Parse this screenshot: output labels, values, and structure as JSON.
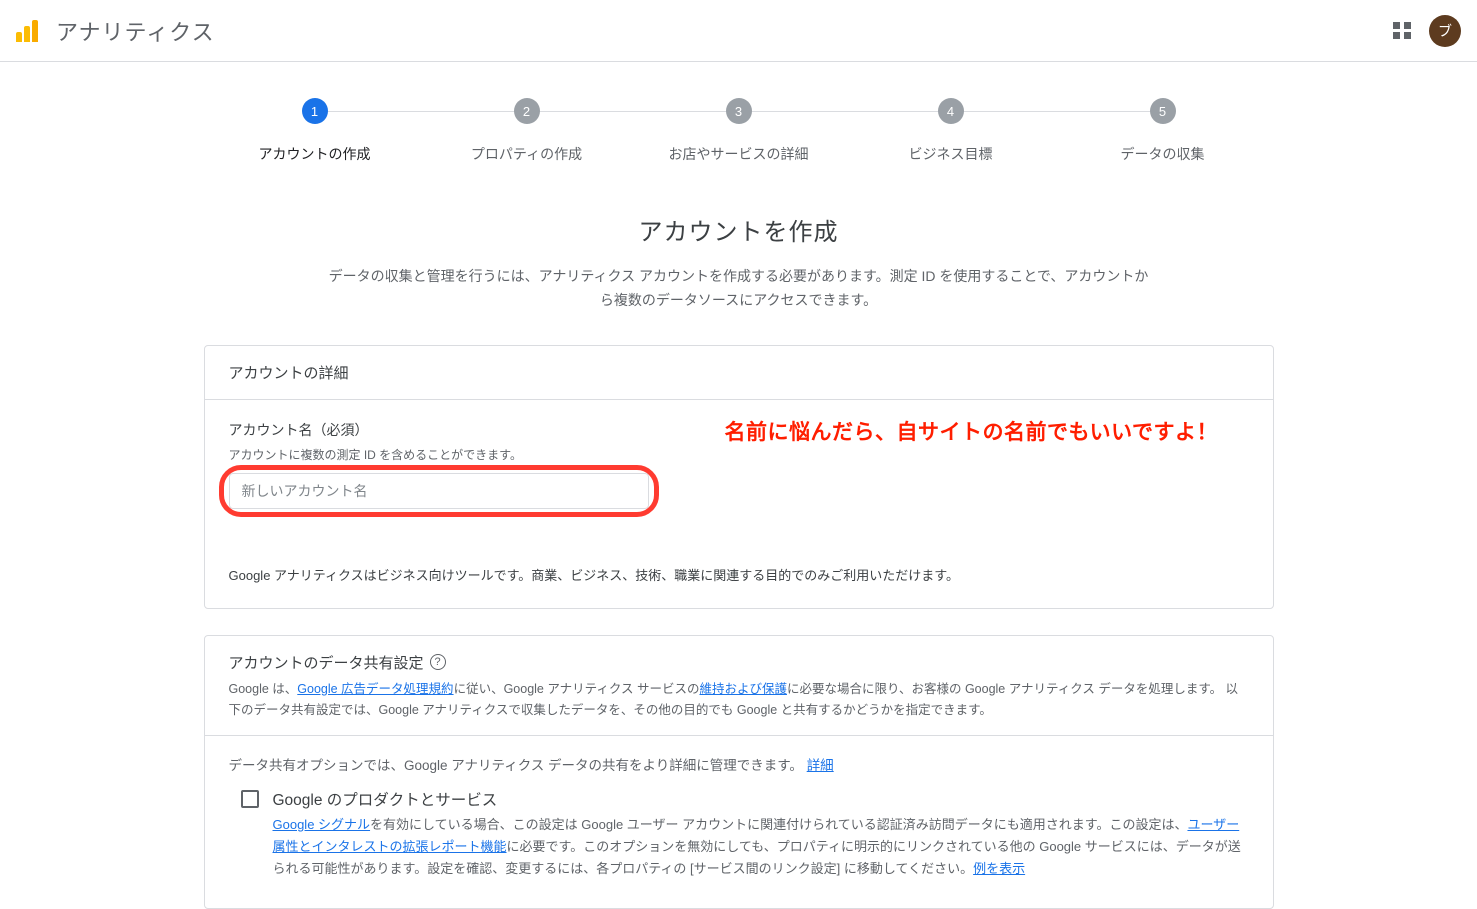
{
  "header": {
    "app_title": "アナリティクス",
    "avatar_initial": "ブ"
  },
  "stepper": {
    "steps": [
      {
        "num": "1",
        "label": "アカウントの作成",
        "active": true
      },
      {
        "num": "2",
        "label": "プロパティの作成",
        "active": false
      },
      {
        "num": "3",
        "label": "お店やサービスの詳細",
        "active": false
      },
      {
        "num": "4",
        "label": "ビジネス目標",
        "active": false
      },
      {
        "num": "5",
        "label": "データの収集",
        "active": false
      }
    ]
  },
  "heading": {
    "title": "アカウントを作成",
    "subtitle": "データの収集と管理を行うには、アナリティクス アカウントを作成する必要があります。測定 ID を使用することで、アカウントから複数のデータソースにアクセスできます。"
  },
  "account_card": {
    "header": "アカウントの詳細",
    "field_label": "アカウント名（必須）",
    "field_hint": "アカウントに複数の測定 ID を含めることができます。",
    "placeholder": "新しいアカウント名",
    "annotation": "名前に悩んだら、自サイトの名前でもいいですよ！",
    "biz_note": "Google アナリティクスはビジネス向けツールです。商業、ビジネス、技術、職業に関連する目的でのみご利用いただけます。"
  },
  "share_card": {
    "title": "アカウントのデータ共有設定",
    "desc_pre": "Google は、",
    "desc_link1": "Google 広告データ処理規約",
    "desc_mid1": "に従い、Google アナリティクス サービスの",
    "desc_link2": "維持および保護",
    "desc_post": "に必要な場合に限り、お客様の Google アナリティクス データを処理します。 以下のデータ共有設定では、Google アナリティクスで収集したデータを、その他の目的でも Google と共有するかどうかを指定できます。",
    "note_text": "データ共有オプションでは、Google アナリティクス データの共有をより詳細に管理できます。 ",
    "note_link": "詳細",
    "option": {
      "title": "Google のプロダクトとサービス",
      "d1_link": "Google シグナル",
      "d1_rest": "を有効にしている場合、この設定は Google ユーザー アカウントに関連付けられている認証済み訪問データにも適用されます。この設定は、",
      "d2_link": "ユーザー属性とインタレストの拡張レポート機能",
      "d2_rest": "に必要です。このオプションを無効にしても、プロパティに明示的にリンクされている他の Google サービスには、データが送られる可能性があります。設定を確認、変更するには、各プロパティの [サービス間のリンク設定] に移動してください。",
      "d3_link": "例を表示"
    }
  }
}
